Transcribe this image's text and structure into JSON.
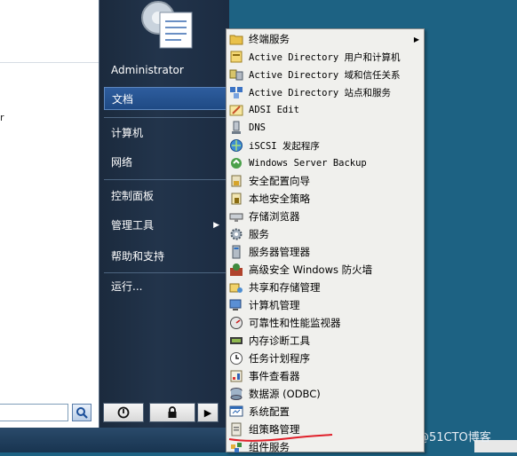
{
  "left_pane": {
    "fragment": "r",
    "search": {
      "value": "",
      "placeholder": ""
    }
  },
  "right_column": {
    "user": "Administrator",
    "items": [
      {
        "label": "文档",
        "highlighted": true
      },
      {
        "label": "计算机"
      },
      {
        "label": "网络"
      },
      {
        "label": "控制面板"
      },
      {
        "label": "管理工具",
        "has_submenu": true
      },
      {
        "label": "帮助和支持"
      },
      {
        "label": "运行..."
      }
    ],
    "arrow_glyph": "▶"
  },
  "power": {
    "shutdown_icon": "power-icon",
    "lock_icon": "lock-icon",
    "more_glyph": "▶"
  },
  "submenu": {
    "arrow_glyph": "▶",
    "items": [
      {
        "label": "终端服务",
        "icon": "folder-icon",
        "has_submenu": true
      },
      {
        "label": "Active Directory 用户和计算机",
        "icon": "ad-users-icon"
      },
      {
        "label": "Active Directory 域和信任关系",
        "icon": "ad-domains-icon"
      },
      {
        "label": "Active Directory 站点和服务",
        "icon": "ad-sites-icon"
      },
      {
        "label": "ADSI Edit",
        "icon": "adsi-icon"
      },
      {
        "label": "DNS",
        "icon": "dns-icon"
      },
      {
        "label": "iSCSI 发起程序",
        "icon": "iscsi-icon"
      },
      {
        "label": "Windows Server Backup",
        "icon": "backup-icon"
      },
      {
        "label": "安全配置向导",
        "icon": "security-wizard-icon"
      },
      {
        "label": "本地安全策略",
        "icon": "local-policy-icon"
      },
      {
        "label": "存储浏览器",
        "icon": "storage-icon"
      },
      {
        "label": "服务",
        "icon": "services-icon"
      },
      {
        "label": "服务器管理器",
        "icon": "server-manager-icon"
      },
      {
        "label": "高级安全 Windows 防火墙",
        "icon": "firewall-icon"
      },
      {
        "label": "共享和存储管理",
        "icon": "share-icon"
      },
      {
        "label": "计算机管理",
        "icon": "computer-mgmt-icon"
      },
      {
        "label": "可靠性和性能监视器",
        "icon": "monitor-icon"
      },
      {
        "label": "内存诊断工具",
        "icon": "memory-icon"
      },
      {
        "label": "任务计划程序",
        "icon": "scheduler-icon"
      },
      {
        "label": "事件查看器",
        "icon": "event-icon"
      },
      {
        "label": "数据源 (ODBC)",
        "icon": "odbc-icon"
      },
      {
        "label": "系统配置",
        "icon": "msconfig-icon"
      },
      {
        "label": "组策略管理",
        "icon": "gpo-icon",
        "annotated": true
      },
      {
        "label": "组件服务",
        "icon": "component-icon"
      }
    ]
  },
  "watermark": "@51CTO博客",
  "colors": {
    "desktop": "#1d6283",
    "highlight": "#2e5d9e",
    "annotation": "#e0202a"
  }
}
